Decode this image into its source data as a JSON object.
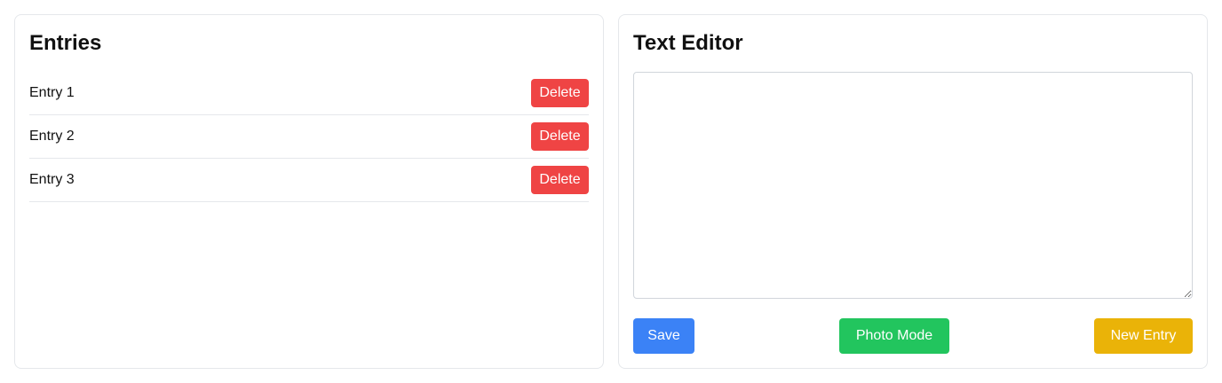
{
  "entries_panel": {
    "title": "Entries",
    "items": [
      {
        "label": "Entry 1",
        "delete_label": "Delete"
      },
      {
        "label": "Entry 2",
        "delete_label": "Delete"
      },
      {
        "label": "Entry 3",
        "delete_label": "Delete"
      }
    ]
  },
  "editor_panel": {
    "title": "Text Editor",
    "textarea_value": "",
    "actions": {
      "save_label": "Save",
      "photo_mode_label": "Photo Mode",
      "new_entry_label": "New Entry"
    }
  },
  "colors": {
    "delete": "#ef4444",
    "save": "#3b82f6",
    "photo_mode": "#22c55e",
    "new_entry": "#eab308",
    "border": "#e5e7eb"
  }
}
